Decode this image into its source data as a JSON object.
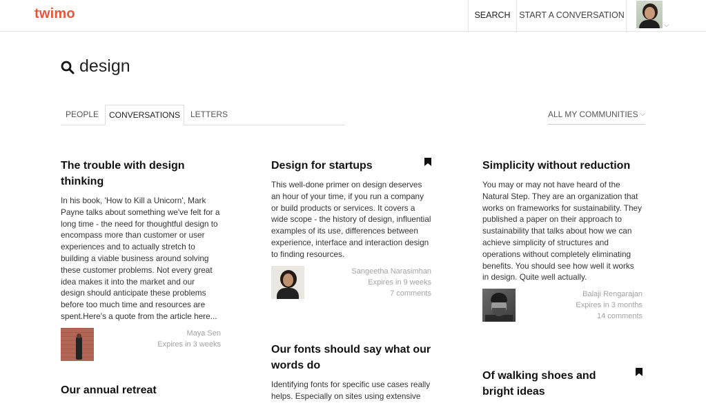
{
  "header": {
    "logo": "twimo",
    "search_label": "SEARCH",
    "start_label": "START A CONVERSATION"
  },
  "search": {
    "term": "design"
  },
  "tabs": [
    {
      "label": "PEOPLE",
      "active": false
    },
    {
      "label": "CONVERSATIONS",
      "active": true
    },
    {
      "label": "LETTERS",
      "active": false
    }
  ],
  "filter": {
    "communities_label": "ALL MY COMMUNITIES"
  },
  "cards": [
    {
      "title": "The trouble with design thinking",
      "body": "In his book, 'How to Kill a Unicorn', Mark Payne talks about something we've felt for a long time - the need for thoughtful design to encompass more than customer or user experiences and to actually stretch to building a viable business around solving these customer problems. Not every great idea makes it into the market and our design should anticipate these problems before too much time and resources are spent.Here's a quote from the article here...",
      "author": "Maya Sen",
      "expires": "Expires in 3 weeks",
      "bookmarked": false
    },
    {
      "title": "Design for startups",
      "body": "This well-done primer on design deserves an hour of your time, if you run a company or build products or services. It covers a wide scope - the history of design, influential examples of its use, differences between experience, interface and interaction design to finding resources.",
      "author": "Sangeetha Narasimhan",
      "expires": "Expires in 9 weeks",
      "comments": "7 comments",
      "bookmarked": true
    },
    {
      "title": "Simplicity without reduction",
      "body": "You may or may not have heard of the Natural Step. They are an organization that works on frameworks for sustainability. They published a paper on their approach to sustainability that talks about how we can achieve simplicity of structures and operations without completely eliminating benefits. You should see how well it works in design. Quite well actually.",
      "author": "Balaji Rengarajan",
      "expires": "Expires in 3 months",
      "comments": "14 comments",
      "bookmarked": false
    },
    {
      "title": "Our annual retreat"
    },
    {
      "title": "Our fonts should say what our words do",
      "body": "Identifying fonts for specific use cases really helps. Especially on sites using extensive use"
    },
    {
      "title": "Of walking shoes and bright ideas",
      "bookmarked": true
    }
  ]
}
